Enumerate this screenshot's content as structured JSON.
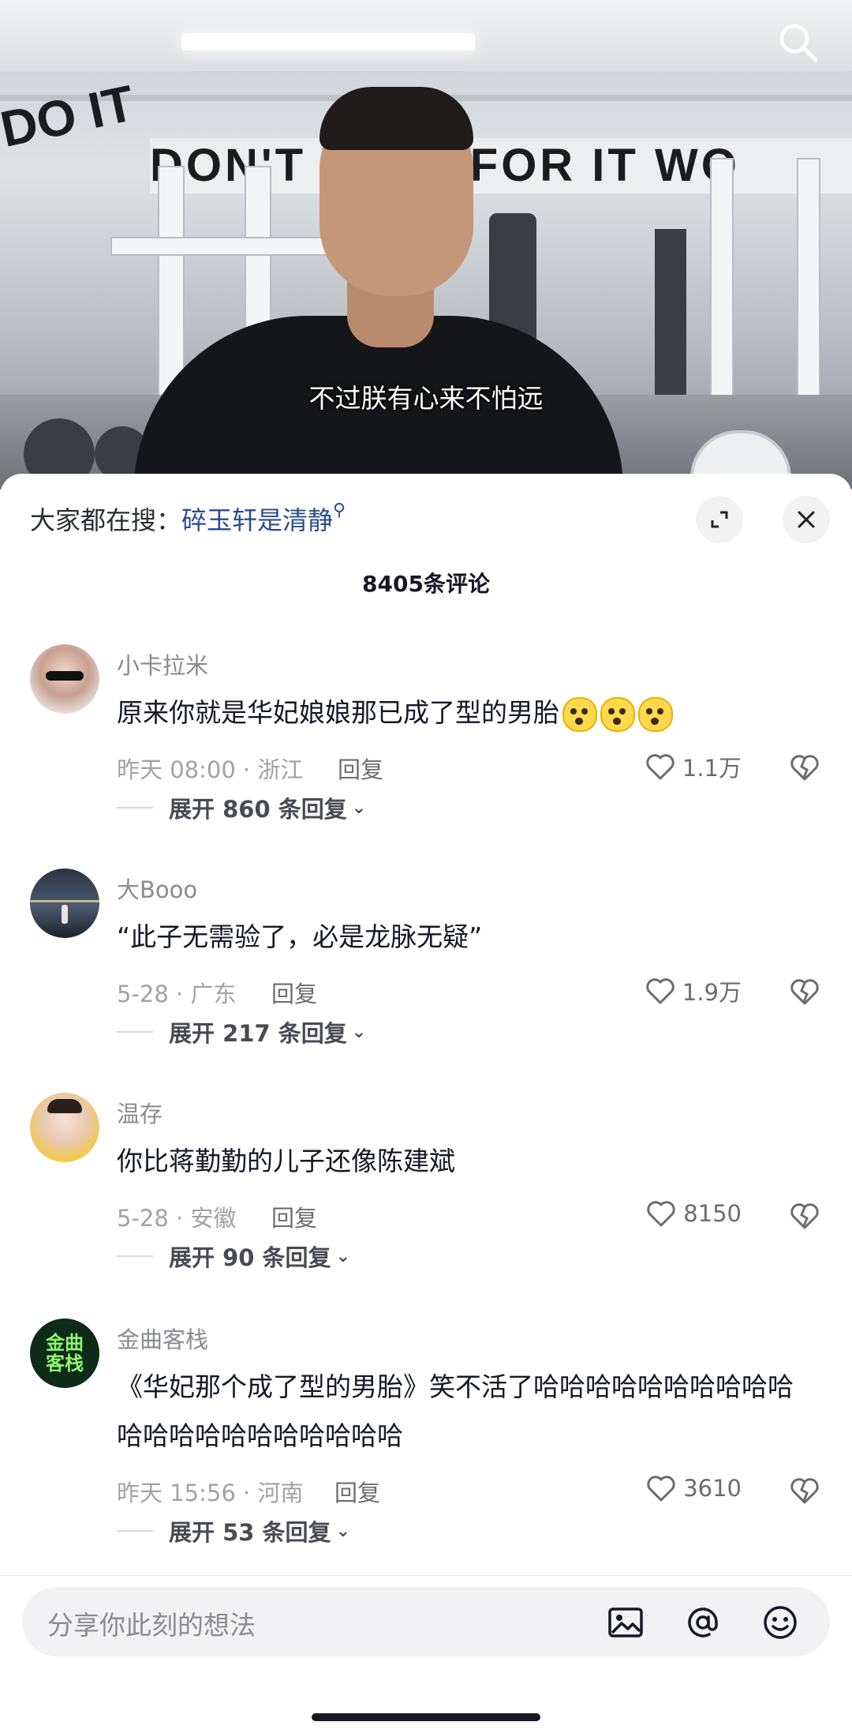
{
  "video": {
    "subtitle": "不过朕有心来不怕远",
    "banner_text": "DON'T WISH FOR IT WO",
    "banner_left": "DO IT",
    "search_icon": "search-icon"
  },
  "comments_panel": {
    "hot_search_prefix": "大家都在搜：",
    "hot_search_term": "碎玉轩是清静",
    "comment_count": "8405条评论",
    "expand_icon": "fullscreen-icon",
    "close_icon": "close-icon"
  },
  "comments": [
    {
      "user": "小卡拉米",
      "text": "原来你就是华妃娘娘那已成了型的男胎",
      "emojis": [
        "shocked-emoji",
        "shocked-emoji",
        "shocked-emoji"
      ],
      "meta": "昨天 08:00 · 浙江",
      "reply": "回复",
      "likes": "1.1万",
      "expand": "展开 860 条回复"
    },
    {
      "user": "大Booo",
      "text": "“此子无需验了，必是龙脉无疑”",
      "meta": "5-28 · 广东",
      "reply": "回复",
      "likes": "1.9万",
      "expand": "展开 217 条回复"
    },
    {
      "user": "温存",
      "text": "你比蒋勤勤的儿子还像陈建斌",
      "meta": "5-28 · 安徽",
      "reply": "回复",
      "likes": "8150",
      "expand": "展开 90 条回复"
    },
    {
      "user": "金曲客栈",
      "text": "《华妃那个成了型的男胎》笑不活了哈哈哈哈哈哈哈哈哈哈哈哈哈哈哈哈哈哈哈哈哈",
      "avatar_text": "金曲客栈",
      "meta": "昨天 15:56 · 河南",
      "reply": "回复",
      "likes": "3610",
      "expand": "展开 53 条回复"
    }
  ],
  "input": {
    "placeholder": "分享你此刻的想法",
    "icons": [
      "image-icon",
      "at-icon",
      "emoji-icon"
    ]
  },
  "colors": {
    "link_blue": "#2b4c8c",
    "meta_gray": "#a1a2a8",
    "text_dark": "#161823"
  }
}
